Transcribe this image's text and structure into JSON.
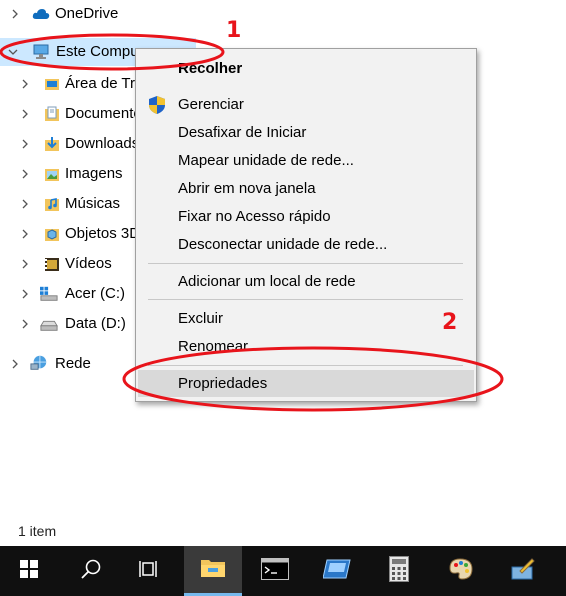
{
  "nav_tree": {
    "items": [
      {
        "label": "OneDrive",
        "icon": "cloud-icon"
      },
      {
        "label": "Este Compu",
        "icon": "computer-icon"
      },
      {
        "label": "Área de Tr",
        "icon": "desktop-folder-icon"
      },
      {
        "label": "Documentos",
        "icon": "documents-folder-icon"
      },
      {
        "label": "Downloads",
        "icon": "downloads-folder-icon"
      },
      {
        "label": "Imagens",
        "icon": "pictures-folder-icon"
      },
      {
        "label": "Músicas",
        "icon": "music-folder-icon"
      },
      {
        "label": "Objetos 3D",
        "icon": "objects3d-folder-icon"
      },
      {
        "label": "Vídeos",
        "icon": "videos-folder-icon"
      },
      {
        "label": "Acer (C:)",
        "icon": "windows-drive-icon"
      },
      {
        "label": "Data (D:)",
        "icon": "drive-icon"
      },
      {
        "label": "Rede",
        "icon": "network-icon"
      }
    ]
  },
  "context_menu": {
    "items": [
      {
        "label": "Recolher",
        "bold": true
      },
      {
        "label": "Gerenciar",
        "icon": "shield-icon"
      },
      {
        "label": "Desafixar de Iniciar"
      },
      {
        "label": "Mapear unidade de rede..."
      },
      {
        "label": "Abrir em nova janela"
      },
      {
        "label": "Fixar no Acesso rápido"
      },
      {
        "label": "Desconectar unidade de rede..."
      },
      {
        "label": "Adicionar um local de rede"
      },
      {
        "label": "Excluir"
      },
      {
        "label": "Renomear"
      },
      {
        "label": "Propriedades",
        "highlighted": true
      }
    ]
  },
  "status_bar": {
    "text": "1 item"
  },
  "annotations": {
    "step1": "1",
    "step2": "2",
    "color": "#e8141b"
  },
  "taskbar": {
    "buttons": [
      {
        "name": "start-button",
        "icon": "windows-logo-icon"
      },
      {
        "name": "search-button",
        "icon": "search-icon"
      },
      {
        "name": "task-view-button",
        "icon": "task-view-icon"
      },
      {
        "name": "file-explorer-button",
        "icon": "folder-icon",
        "active": true
      },
      {
        "name": "cmd-button",
        "icon": "terminal-icon"
      },
      {
        "name": "app-button",
        "icon": "window-app-icon"
      },
      {
        "name": "calculator-button",
        "icon": "calculator-icon"
      },
      {
        "name": "paint-button",
        "icon": "paint-palette-icon"
      }
    ]
  }
}
